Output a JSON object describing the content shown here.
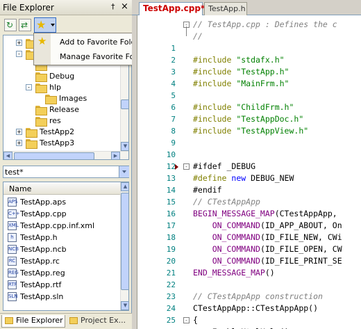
{
  "panel": {
    "title": "File Explorer",
    "pin_glyph": "†",
    "close_glyph": "×"
  },
  "toolbar": {
    "refresh_glyph": "↻",
    "sync_glyph": "⇄",
    "favorites_glyph": "★"
  },
  "tree": {
    "items": [
      {
        "label": "",
        "indent": 0,
        "expander": "+",
        "folder": true
      },
      {
        "label": "",
        "indent": 0,
        "expander": "-",
        "folder": true
      },
      {
        "label": "",
        "indent": 1,
        "expander": "",
        "folder": true
      },
      {
        "label": "Debug",
        "indent": 1,
        "expander": "",
        "folder": true
      },
      {
        "label": "hlp",
        "indent": 1,
        "expander": "-",
        "folder": true
      },
      {
        "label": "Images",
        "indent": 2,
        "expander": "",
        "folder": true
      },
      {
        "label": "Release",
        "indent": 1,
        "expander": "",
        "folder": true
      },
      {
        "label": "res",
        "indent": 1,
        "expander": "",
        "folder": true
      },
      {
        "label": "TestApp2",
        "indent": 0,
        "expander": "+",
        "folder": true
      },
      {
        "label": "TestApp3",
        "indent": 0,
        "expander": "+",
        "folder": true
      }
    ]
  },
  "favorites_menu": {
    "items": [
      {
        "label": "Add to Favorite Folders",
        "icon": "star-icon"
      },
      {
        "label": "Manage Favorite Folders...",
        "icon": ""
      }
    ]
  },
  "filter": {
    "value": "test*"
  },
  "files": {
    "column": "Name",
    "items": [
      {
        "name": "TestApp.aps",
        "icon": "APS"
      },
      {
        "name": "TestApp.cpp",
        "icon": "C++"
      },
      {
        "name": "TestApp.cpp.inf.xml",
        "icon": "XML"
      },
      {
        "name": "TestApp.h",
        "icon": "h"
      },
      {
        "name": "TestApp.ncb",
        "icon": "NCB"
      },
      {
        "name": "TestApp.rc",
        "icon": "RC"
      },
      {
        "name": "TestApp.reg",
        "icon": "REG"
      },
      {
        "name": "TestApp.rtf",
        "icon": "RTF"
      },
      {
        "name": "TestApp.sln",
        "icon": "SLN"
      }
    ]
  },
  "bottom_tabs": [
    {
      "label": "File Explorer",
      "active": true
    },
    {
      "label": "Project Ex...",
      "active": false
    }
  ],
  "editor": {
    "tabs": [
      {
        "label": "TestApp.cpp*",
        "active": true
      },
      {
        "label": "TestApp.h",
        "active": false
      }
    ],
    "lines": [
      {
        "n": "",
        "fold": "-",
        "tokens": [
          [
            "cm",
            "// TestApp.cpp : Defines the c"
          ]
        ]
      },
      {
        "n": "",
        "fold": "",
        "tokens": [
          [
            "cm",
            "//"
          ]
        ]
      },
      {
        "n": "1",
        "fold": "",
        "tokens": []
      },
      {
        "n": "2",
        "fold": "",
        "tokens": [
          [
            "pp",
            "#include "
          ],
          [
            "st",
            "\"stdafx.h\""
          ]
        ]
      },
      {
        "n": "3",
        "fold": "",
        "tokens": [
          [
            "pp",
            "#include "
          ],
          [
            "st",
            "\"TestApp.h\""
          ]
        ]
      },
      {
        "n": "4",
        "fold": "",
        "tokens": [
          [
            "pp",
            "#include "
          ],
          [
            "st",
            "\"MainFrm.h\""
          ]
        ]
      },
      {
        "n": "5",
        "fold": "",
        "tokens": []
      },
      {
        "n": "6",
        "fold": "",
        "tokens": [
          [
            "pp",
            "#include "
          ],
          [
            "st",
            "\"ChildFrm.h\""
          ]
        ]
      },
      {
        "n": "7",
        "fold": "",
        "tokens": [
          [
            "pp",
            "#include "
          ],
          [
            "st",
            "\"TestAppDoc.h\""
          ]
        ]
      },
      {
        "n": "8",
        "fold": "",
        "tokens": [
          [
            "pp",
            "#include "
          ],
          [
            "st",
            "\"TestAppView.h\""
          ]
        ]
      },
      {
        "n": "9",
        "fold": "",
        "tokens": []
      },
      {
        "n": "10",
        "fold": "",
        "tokens": []
      },
      {
        "n": "12",
        "fold": "-",
        "tokens": [
          [
            "pl",
            "#ifdef _DEBUG"
          ]
        ]
      },
      {
        "n": "13",
        "fold": "",
        "tokens": [
          [
            "pp",
            "#define "
          ],
          [
            "kw",
            "new "
          ],
          [
            "id",
            "DEBUG_NEW"
          ]
        ]
      },
      {
        "n": "14",
        "fold": "",
        "tokens": [
          [
            "pl",
            "#endif"
          ]
        ]
      },
      {
        "n": "15",
        "fold": "",
        "tokens": [
          [
            "cm",
            "// CTestAppApp"
          ]
        ]
      },
      {
        "n": "16",
        "fold": "",
        "tokens": [
          [
            "mc",
            "BEGIN_MESSAGE_MAP"
          ],
          [
            "pl",
            "(CTestAppApp, "
          ]
        ]
      },
      {
        "n": "17",
        "fold": "",
        "tokens": [
          [
            "pl",
            "    "
          ],
          [
            "mc",
            "ON_COMMAND"
          ],
          [
            "pl",
            "(ID_APP_ABOUT, On"
          ]
        ]
      },
      {
        "n": "18",
        "fold": "",
        "tokens": [
          [
            "pl",
            "    "
          ],
          [
            "mc",
            "ON_COMMAND"
          ],
          [
            "pl",
            "(ID_FILE_NEW, CWi"
          ]
        ]
      },
      {
        "n": "19",
        "fold": "",
        "tokens": [
          [
            "pl",
            "    "
          ],
          [
            "mc",
            "ON_COMMAND"
          ],
          [
            "pl",
            "(ID_FILE_OPEN, CW"
          ]
        ]
      },
      {
        "n": "20",
        "fold": "",
        "tokens": [
          [
            "pl",
            "    "
          ],
          [
            "mc",
            "ON_COMMAND"
          ],
          [
            "pl",
            "(ID_FILE_PRINT_SE"
          ]
        ]
      },
      {
        "n": "21",
        "fold": "",
        "tokens": [
          [
            "mc",
            "END_MESSAGE_MAP"
          ],
          [
            "pl",
            "()"
          ]
        ]
      },
      {
        "n": "22",
        "fold": "",
        "tokens": []
      },
      {
        "n": "23",
        "fold": "",
        "tokens": [
          [
            "cm",
            "// CTestAppApp construction"
          ]
        ]
      },
      {
        "n": "24",
        "fold": "",
        "tokens": [
          [
            "pl",
            "CTestAppApp::CTestAppApp()"
          ]
        ]
      },
      {
        "n": "25",
        "fold": "-",
        "tokens": [
          [
            "pl",
            "{"
          ]
        ]
      },
      {
        "n": "26",
        "fold": "",
        "tokens": [
          [
            "pl",
            "    "
          ],
          [
            "id",
            "EnableHtmlHelp"
          ],
          [
            "pl",
            "();"
          ]
        ]
      }
    ]
  }
}
